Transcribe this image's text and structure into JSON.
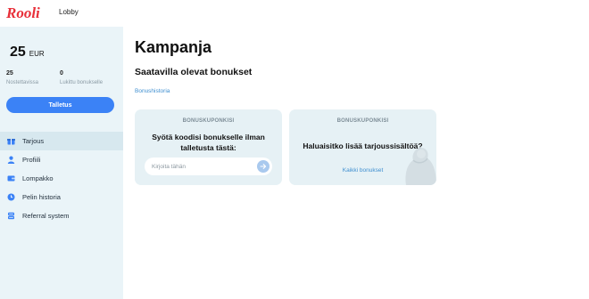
{
  "header": {
    "logo_text": "Rooli",
    "lobby_label": "Lobby"
  },
  "sidebar": {
    "balance_amount": "25",
    "balance_currency": "EUR",
    "stats": [
      {
        "value": "25",
        "label": "Nostettavissa"
      },
      {
        "value": "0",
        "label": "Lukittu bonukselle"
      }
    ],
    "deposit_label": "Talletus",
    "items": [
      {
        "label": "Tarjous",
        "icon": "gift-icon",
        "active": true
      },
      {
        "label": "Profiili",
        "icon": "user-icon",
        "active": false
      },
      {
        "label": "Lompakko",
        "icon": "wallet-icon",
        "active": false
      },
      {
        "label": "Pelin historia",
        "icon": "clock-icon",
        "active": false
      },
      {
        "label": "Referral system",
        "icon": "referral-icon",
        "active": false
      }
    ]
  },
  "main": {
    "title": "Kampanja",
    "subtitle": "Saatavilla olevat bonukset",
    "history_link": "Bonushistoria",
    "coupon_card": {
      "caption": "BONUSKUPONKISI",
      "headline": "Syötä koodisi bonukselle ilman talletusta tästä:",
      "input_placeholder": "Kirjoita tähän",
      "input_value": ""
    },
    "offers_card": {
      "caption": "BONUSKUPONKISI",
      "headline": "Haluaisitko lisää tarjoussisältöä?",
      "link_label": "Kaikki bonukset"
    }
  },
  "colors": {
    "brand": "#e8303a",
    "accent": "#3b82f6",
    "sidebar_bg": "#eaf4f8",
    "card_bg": "#e6f1f5",
    "link": "#3f8fd0"
  }
}
